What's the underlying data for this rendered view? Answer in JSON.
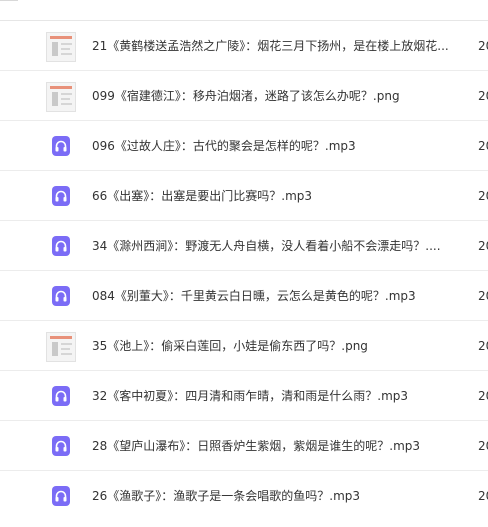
{
  "files": [
    {
      "type": "image",
      "icon": "image-thumbnail-icon",
      "name": "21《黄鹤楼送孟浩然之广陵》：烟花三月下扬州，是在楼上放烟花...",
      "date": "20"
    },
    {
      "type": "image",
      "icon": "image-thumbnail-icon",
      "name": "099《宿建德江》：移舟泊烟渚，迷路了该怎么办呢？.png",
      "date": "20"
    },
    {
      "type": "audio",
      "icon": "headphones-icon",
      "name": "096《过故人庄》：古代的聚会是怎样的呢？.mp3",
      "date": "20"
    },
    {
      "type": "audio",
      "icon": "headphones-icon",
      "name": "66《出塞》：出塞是要出门比赛吗？.mp3",
      "date": "20"
    },
    {
      "type": "audio",
      "icon": "headphones-icon",
      "name": "34《滁州西涧》：野渡无人舟自横，没人看着小船不会漂走吗？....",
      "date": "20"
    },
    {
      "type": "audio",
      "icon": "headphones-icon",
      "name": "084《别董大》：千里黄云白日曛，云怎么是黄色的呢？.mp3",
      "date": "20"
    },
    {
      "type": "image",
      "icon": "image-thumbnail-icon",
      "name": "35《池上》：偷采白莲回，小娃是偷东西了吗？.png",
      "date": "20"
    },
    {
      "type": "audio",
      "icon": "headphones-icon",
      "name": "32《客中初夏》：四月清和雨乍晴，清和雨是什么雨？.mp3",
      "date": "20"
    },
    {
      "type": "audio",
      "icon": "headphones-icon",
      "name": "28《望庐山瀑布》：日照香炉生紫烟，紫烟是谁生的呢？.mp3",
      "date": "20"
    },
    {
      "type": "audio",
      "icon": "headphones-icon",
      "name": "26《渔歌子》：渔歌子是一条会唱歌的鱼吗？.mp3",
      "date": "20"
    }
  ],
  "colors": {
    "audio_icon": "#7b6cf6",
    "thumb_accent": "#e8917a"
  }
}
